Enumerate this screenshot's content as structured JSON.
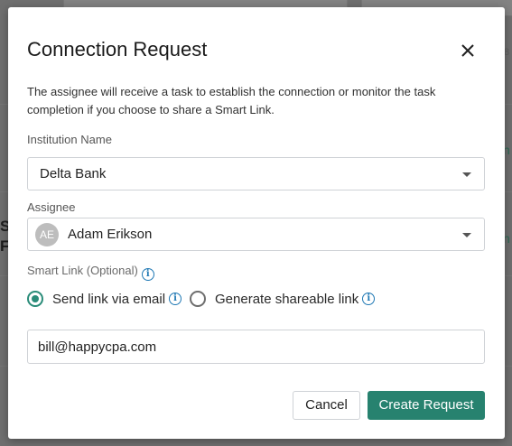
{
  "modal": {
    "title": "Connection Request",
    "close_icon": "close-icon",
    "description": "The assignee will receive a task to establish the connection or monitor the task completion if you choose to share a Smart Link."
  },
  "institution": {
    "label": "Institution Name",
    "value": "Delta Bank"
  },
  "assignee": {
    "label": "Assignee",
    "initials": "AE",
    "value": "Adam Erikson"
  },
  "smart_link": {
    "label": "Smart Link (Optional)",
    "options": [
      {
        "label": "Send link via email",
        "checked": true
      },
      {
        "label": "Generate shareable link",
        "checked": false
      }
    ]
  },
  "email": {
    "value": "bill@happycpa.com"
  },
  "actions": {
    "cancel": "Cancel",
    "create": "Create Request"
  },
  "colors": {
    "accent": "#27826f",
    "info": "#1f78b4"
  }
}
